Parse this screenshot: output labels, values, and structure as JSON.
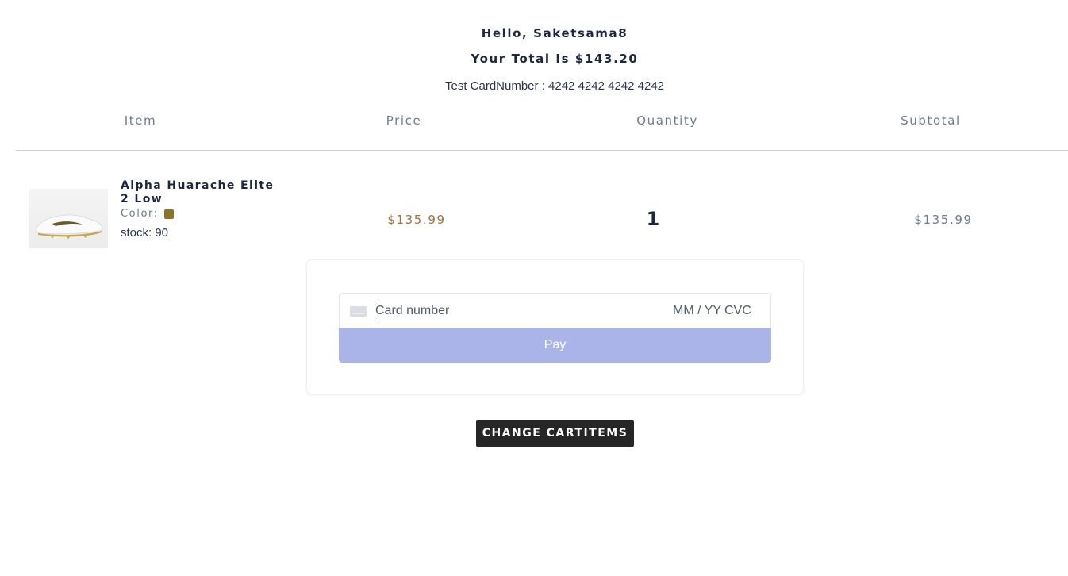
{
  "header": {
    "greeting": "Hello, Saketsama8",
    "total": "Your Total Is $143.20",
    "test_card": "Test CardNumber : 4242 4242 4242 4242"
  },
  "table": {
    "columns": [
      "Item",
      "Price",
      "Quantity",
      "Subtotal"
    ],
    "rows": [
      {
        "name": "Alpha Huarache Elite 2 Low",
        "color_label": "Color:",
        "color_hex": "#8a7428",
        "stock": "stock: 90",
        "price": "$135.99",
        "quantity": "1",
        "subtotal": "$135.99",
        "image_icon": "shoe-image"
      }
    ]
  },
  "payment": {
    "card_placeholder": "Card number",
    "exp_placeholder": "MM / YY",
    "cvc_placeholder": "CVC",
    "card_icon": "credit-card-icon",
    "pay_label": "Pay",
    "pay_color": "#aab4e9"
  },
  "actions": {
    "change_cart_label": "CHANGE CARTITEMS"
  }
}
